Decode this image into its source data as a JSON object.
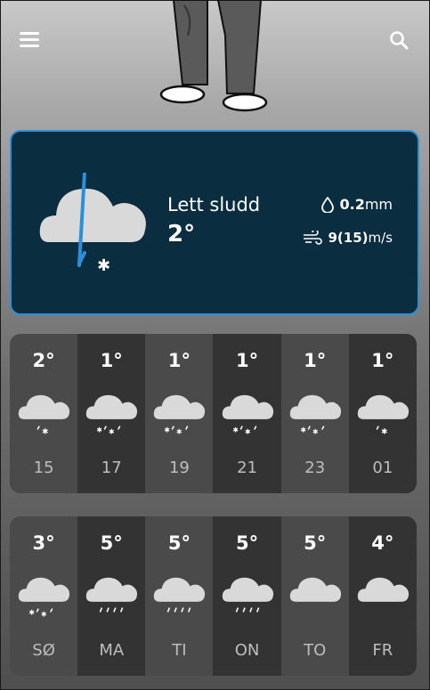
{
  "header": {
    "menu_icon": "hamburger-menu-icon",
    "search_icon": "search-icon"
  },
  "current": {
    "description": "Lett sludd",
    "temperature": "2°",
    "precip_value": "0.2",
    "precip_unit": "mm",
    "wind_value": "9(15)",
    "wind_unit": "m/s",
    "icon": "cloud-sleet-icon"
  },
  "hourly": [
    {
      "temp": "2°",
      "label": "15",
      "icon": "cloud-sleet-light"
    },
    {
      "temp": "1°",
      "label": "17",
      "icon": "cloud-sleet"
    },
    {
      "temp": "1°",
      "label": "19",
      "icon": "cloud-sleet"
    },
    {
      "temp": "1°",
      "label": "21",
      "icon": "cloud-sleet"
    },
    {
      "temp": "1°",
      "label": "23",
      "icon": "cloud-sleet"
    },
    {
      "temp": "1°",
      "label": "01",
      "icon": "cloud-sleet-light"
    }
  ],
  "daily": [
    {
      "temp": "3°",
      "label": "SØ",
      "icon": "cloud-sleet"
    },
    {
      "temp": "5°",
      "label": "MA",
      "icon": "cloud-rain"
    },
    {
      "temp": "5°",
      "label": "TI",
      "icon": "cloud-rain"
    },
    {
      "temp": "5°",
      "label": "ON",
      "icon": "cloud-rain"
    },
    {
      "temp": "5°",
      "label": "TO",
      "icon": "cloud"
    },
    {
      "temp": "4°",
      "label": "FR",
      "icon": "cloud"
    }
  ],
  "colors": {
    "card_bg": "#0b2d40",
    "card_border": "#2b8fd9",
    "rain": "#2b8fd9"
  }
}
